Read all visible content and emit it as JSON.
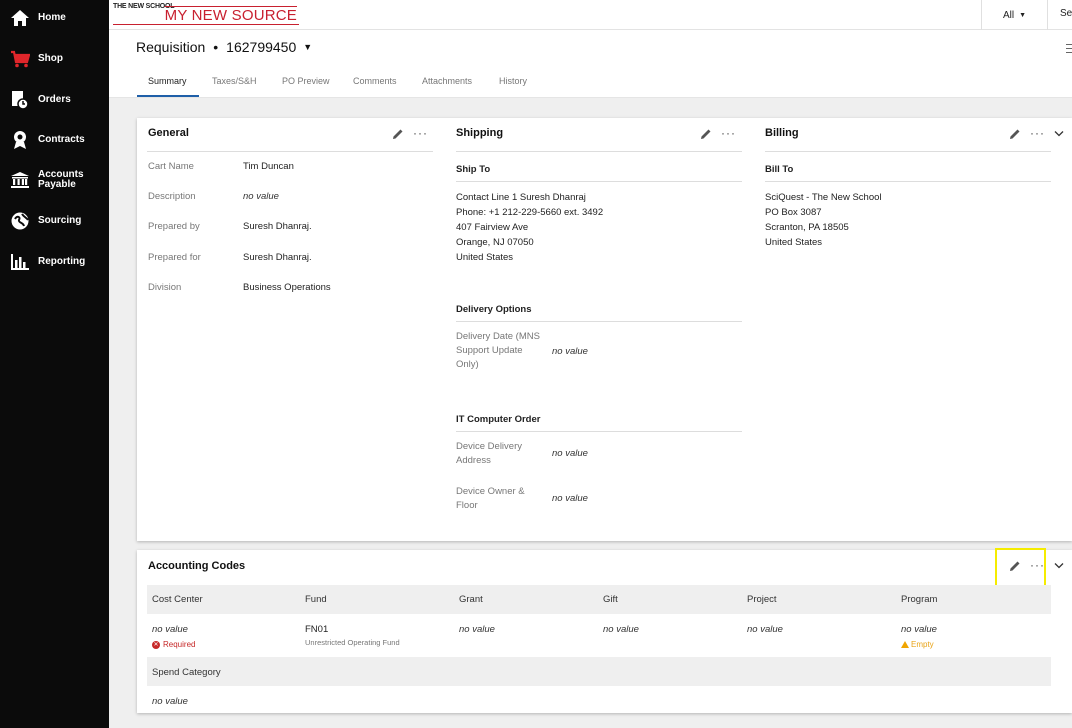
{
  "sidebar": {
    "items": [
      {
        "label": "Home",
        "icon": "home-icon"
      },
      {
        "label": "Shop",
        "icon": "cart-icon"
      },
      {
        "label": "Orders",
        "icon": "orders-icon"
      },
      {
        "label": "Contracts",
        "icon": "contracts-icon"
      },
      {
        "label": "Accounts",
        "label2": "Payable",
        "icon": "bank-icon"
      },
      {
        "label": "Sourcing",
        "icon": "sourcing-icon"
      },
      {
        "label": "Reporting",
        "icon": "chart-icon"
      }
    ]
  },
  "topbar": {
    "logo_small": "THE NEW SCHOOL",
    "logo_big": "MY NEW SOURCE",
    "scope": "All",
    "search_stub": "Sea"
  },
  "header": {
    "doc_type": "Requisition",
    "separator": "•",
    "doc_number": "162799450",
    "tabs": [
      "Summary",
      "Taxes/S&H",
      "PO Preview",
      "Comments",
      "Attachments",
      "History"
    ]
  },
  "general": {
    "title": "General",
    "fields": [
      {
        "label": "Cart Name",
        "value": "Tim Duncan"
      },
      {
        "label": "Description",
        "value": "no value"
      },
      {
        "label": "Prepared by",
        "value": "Suresh Dhanraj."
      },
      {
        "label": "Prepared for",
        "value": "Suresh Dhanraj."
      },
      {
        "label": "Division",
        "value": "Business Operations"
      }
    ]
  },
  "shipping": {
    "title": "Shipping",
    "ship_to_title": "Ship To",
    "ship_to_lines": [
      "Contact Line 1 Suresh Dhanraj",
      "Phone: +1 212-229-5660 ext. 3492",
      "407 Fairview Ave",
      "Orange, NJ 07050",
      "United States"
    ],
    "delivery_title": "Delivery Options",
    "delivery_label_lines": [
      "Delivery Date (MNS",
      "Support Update",
      "Only)"
    ],
    "delivery_value": "no value",
    "it_title": "IT Computer Order",
    "device_address_lines": [
      "Device Delivery",
      "Address"
    ],
    "device_address_value": "no value",
    "device_owner_lines": [
      "Device Owner &",
      "Floor"
    ],
    "device_owner_value": "no value"
  },
  "billing": {
    "title": "Billing",
    "bill_to_title": "Bill To",
    "bill_to_lines": [
      "SciQuest - The New School",
      "PO Box 3087",
      "Scranton, PA 18505",
      "United States"
    ]
  },
  "accounting": {
    "title": "Accounting Codes",
    "columns": [
      {
        "header": "Cost Center",
        "value": "no value",
        "badge": "Required"
      },
      {
        "header": "Fund",
        "value": "FN01",
        "sub": "Unrestricted Operating Fund"
      },
      {
        "header": "Grant",
        "value": "no value"
      },
      {
        "header": "Gift",
        "value": "no value"
      },
      {
        "header": "Project",
        "value": "no value"
      },
      {
        "header": "Program",
        "value": "no value",
        "badge": "Empty"
      }
    ],
    "row2_header": "Spend Category",
    "row2_value": "no value"
  },
  "colors": {
    "sidebar_bg": "#0b0b0b",
    "shop_icon": "#e0262b",
    "brand_red": "#c8202f",
    "tab_underline": "#1f5fa8",
    "required": "#c62828",
    "empty_warning": "#f0a500",
    "highlight": "#f5ec00"
  }
}
